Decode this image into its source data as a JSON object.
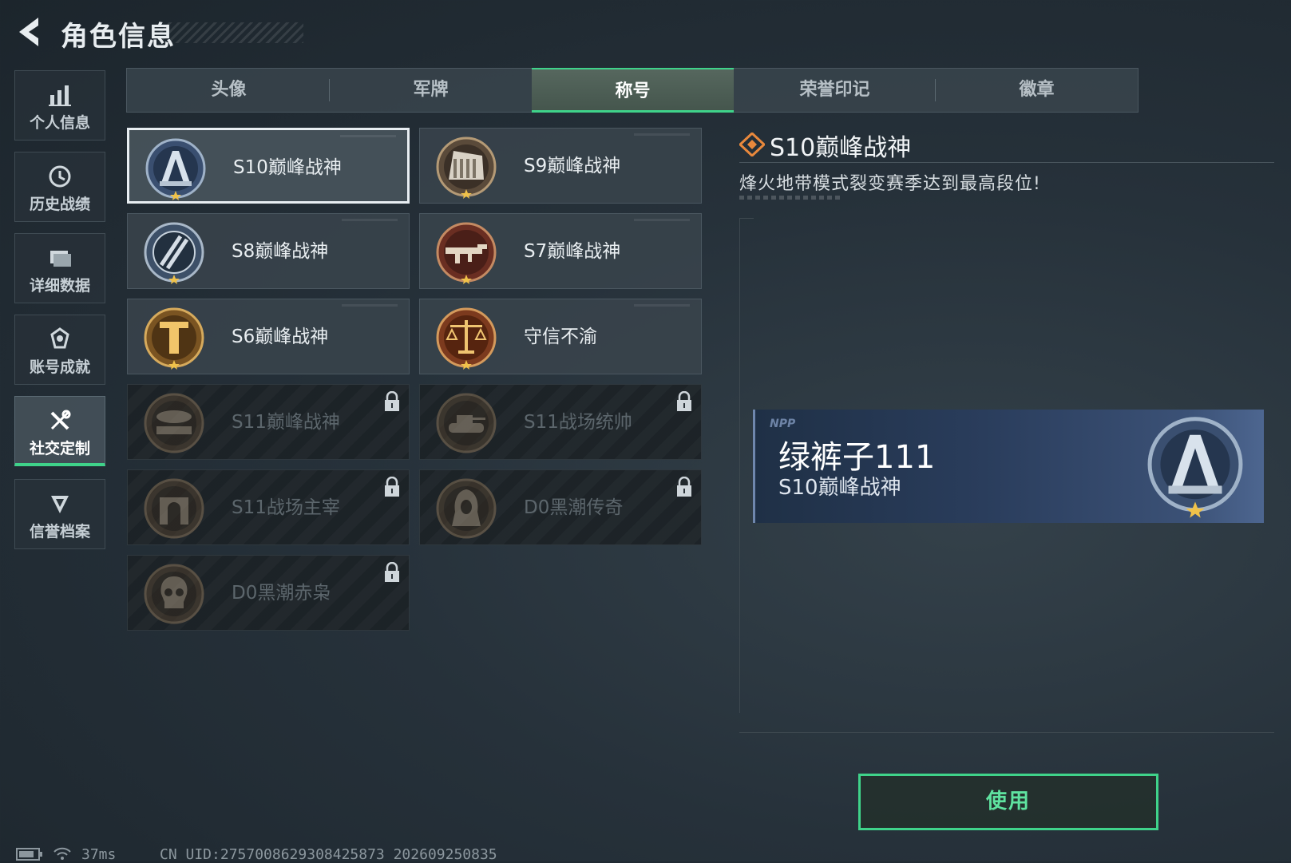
{
  "header": {
    "title": "角色信息"
  },
  "sidebar": {
    "items": [
      {
        "label": "个人信息",
        "icon": "bar-chart-icon"
      },
      {
        "label": "历史战绩",
        "icon": "history-clock-icon"
      },
      {
        "label": "详细数据",
        "icon": "folder-icon"
      },
      {
        "label": "账号成就",
        "icon": "achievement-icon"
      },
      {
        "label": "社交定制",
        "icon": "tools-icon",
        "active": true
      },
      {
        "label": "信誉档案",
        "icon": "shield-icon"
      }
    ]
  },
  "tabs": [
    "头像",
    "军牌",
    "称号",
    "荣誉印记",
    "徽章"
  ],
  "active_tab": "称号",
  "titles": [
    {
      "name": "S10巅峰战神",
      "locked": false,
      "selected": true,
      "emblem": "mountain-emblem-icon"
    },
    {
      "name": "S9巅峰战神",
      "locked": false,
      "emblem": "dam-emblem-icon"
    },
    {
      "name": "S8巅峰战神",
      "locked": false,
      "emblem": "stripes-emblem-icon"
    },
    {
      "name": "S7巅峰战神",
      "locked": false,
      "emblem": "rifle-emblem-icon"
    },
    {
      "name": "S6巅峰战神",
      "locked": false,
      "emblem": "t-shield-emblem-icon"
    },
    {
      "name": "守信不渝",
      "locked": false,
      "emblem": "scales-emblem-icon"
    },
    {
      "name": "S11巅峰战神",
      "locked": true,
      "emblem": "airship-emblem-icon"
    },
    {
      "name": "S11战场统帅",
      "locked": true,
      "emblem": "tank-emblem-icon"
    },
    {
      "name": "S11战场主宰",
      "locked": true,
      "emblem": "arch-emblem-icon"
    },
    {
      "name": "D0黑潮传奇",
      "locked": true,
      "emblem": "hooded-figure-emblem-icon"
    },
    {
      "name": "D0黑潮赤枭",
      "locked": true,
      "emblem": "skull-emblem-icon"
    }
  ],
  "detail": {
    "title": "S10巅峰战神",
    "description": "烽火地带模式裂变赛季达到最高段位!"
  },
  "preview": {
    "player_name": "绿裤子111",
    "title": "S10巅峰战神"
  },
  "use_button": "使用",
  "status": {
    "ping": "37ms",
    "uid": "CN UID:2757008629308425873 202609250835"
  },
  "colors": {
    "accent": "#3fd38a",
    "background": "#26313a",
    "banner": "#2a3d5c"
  }
}
